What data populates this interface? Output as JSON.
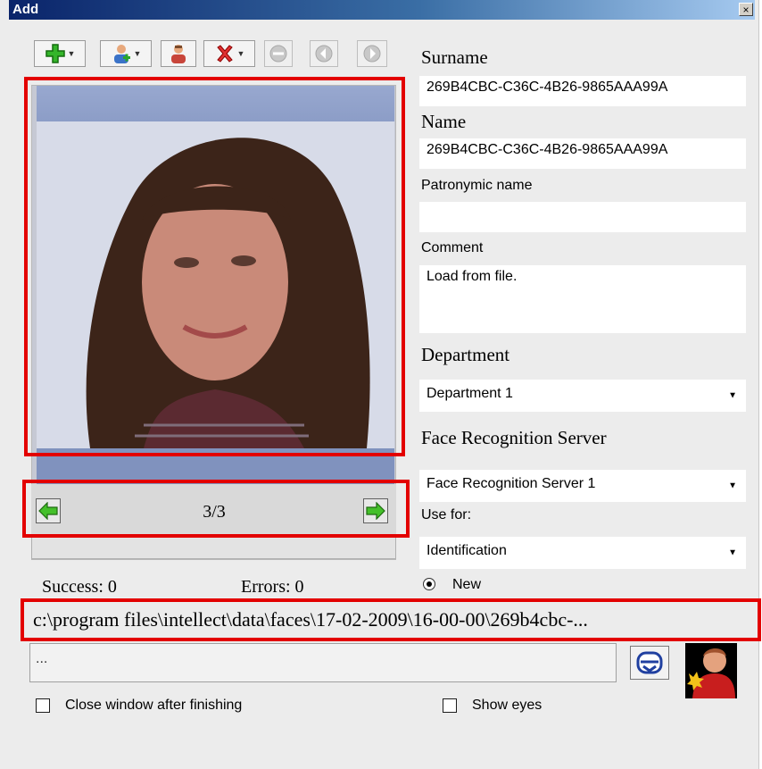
{
  "window": {
    "title": "Add",
    "close": "×"
  },
  "photo": {
    "counter": "3/3"
  },
  "form": {
    "surname_label": "Surname",
    "surname_value": "269B4CBC-C36C-4B26-9865AAA99A",
    "name_label": "Name",
    "name_value": "269B4CBC-C36C-4B26-9865AAA99A",
    "patronymic_label": "Patronymic name",
    "patronymic_value": "",
    "comment_label": "Comment",
    "comment_value": "Load from file.",
    "department_label": "Department",
    "department_value": "Department 1",
    "server_label": "Face Recognition Server",
    "server_value": "Face Recognition Server 1",
    "use_for_label": "Use for:",
    "use_for_value": "Identification",
    "radio_new_label": "New"
  },
  "stats": {
    "success": "Success: 0",
    "errors": "Errors: 0"
  },
  "path": "c:\\program files\\intellect\\data\\faces\\17-02-2009\\16-00-00\\269b4cbc-...",
  "status_text": "...",
  "options": {
    "close_after_label": "Close window after finishing",
    "show_eyes_label": "Show eyes"
  },
  "icons": {
    "toolbar": [
      "add-icon",
      "add-person-icon",
      "person-icon",
      "delete-icon",
      "remove-icon",
      "back-icon",
      "forward-icon"
    ],
    "nav": [
      "arrow-left-icon",
      "arrow-right-icon"
    ]
  },
  "colors": {
    "highlight": "#e30000",
    "titlebar": "#0a246a"
  }
}
